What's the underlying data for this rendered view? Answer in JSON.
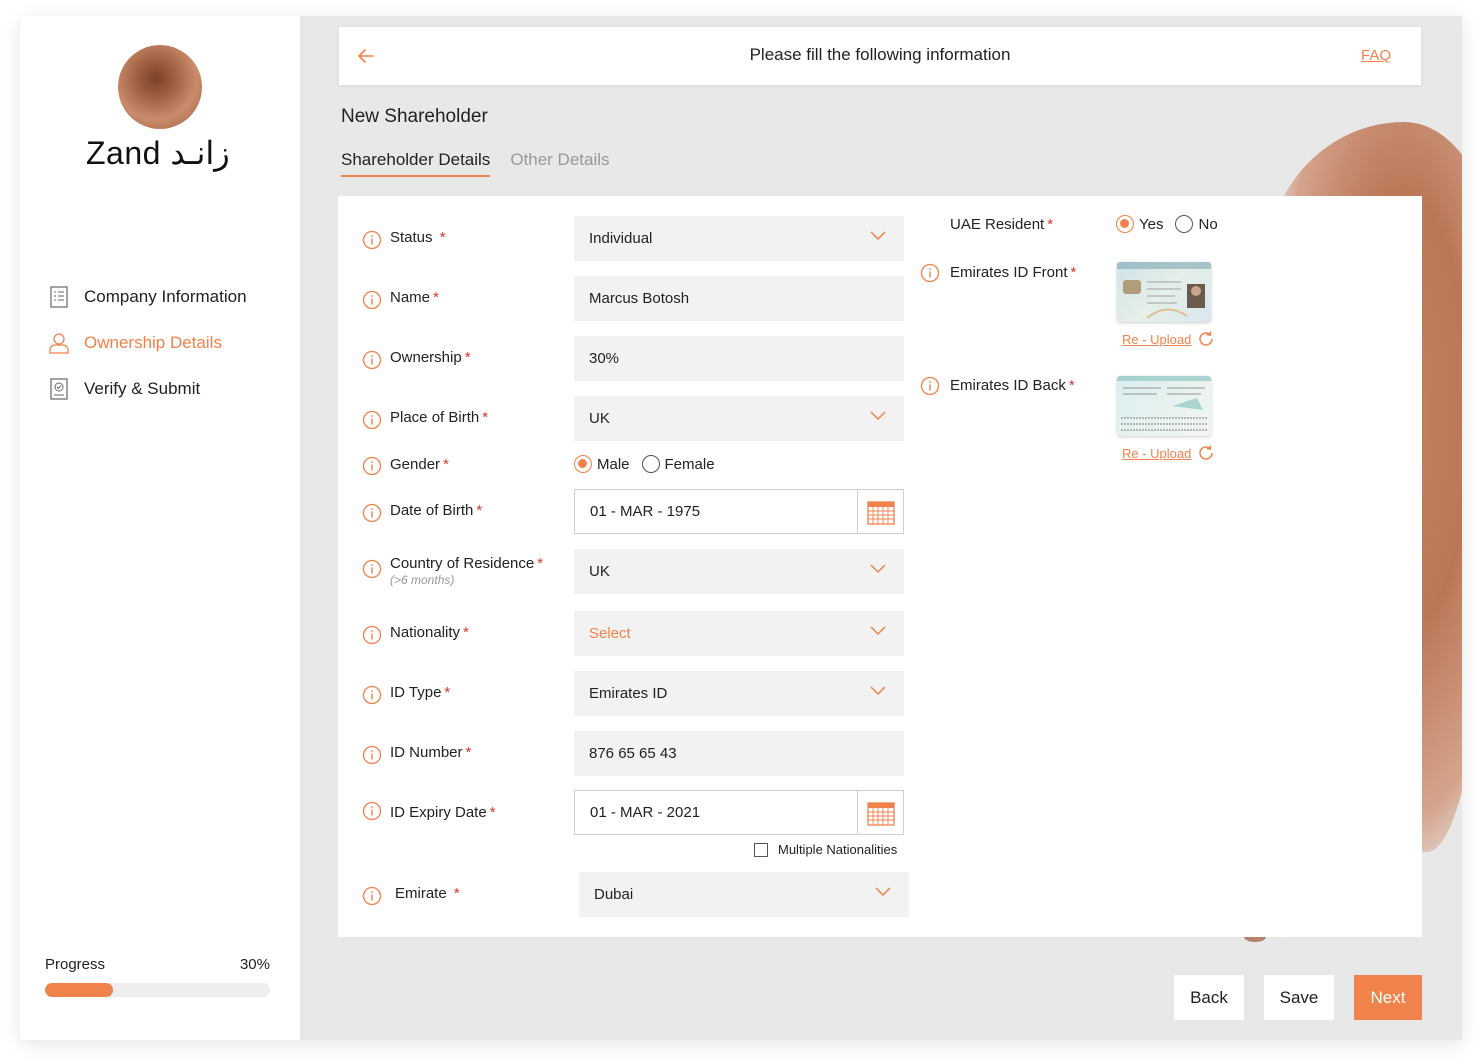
{
  "brand": {
    "logo_text": "Zand زانـد"
  },
  "sidebar": {
    "items": [
      {
        "label": "Company Information",
        "icon": "document-icon",
        "active": false
      },
      {
        "label": "Ownership Details",
        "icon": "user-icon",
        "active": true
      },
      {
        "label": "Verify & Submit",
        "icon": "verify-icon",
        "active": false
      }
    ],
    "progress": {
      "label": "Progress",
      "value_text": "30%",
      "value": 0.3
    }
  },
  "header": {
    "title": "Please fill the following information",
    "faq": "FAQ"
  },
  "section": {
    "title": "New Shareholder"
  },
  "tabs": [
    {
      "label": "Shareholder Details",
      "active": true
    },
    {
      "label": "Other Details",
      "active": false
    }
  ],
  "form": {
    "status": {
      "label": "Status",
      "value": "Individual"
    },
    "name": {
      "label": "Name",
      "value": "Marcus Botosh"
    },
    "ownership": {
      "label": "Ownership",
      "value": "30%"
    },
    "place_of_birth": {
      "label": "Place of Birth",
      "value": "UK"
    },
    "gender": {
      "label": "Gender",
      "options": [
        "Male",
        "Female"
      ],
      "selected": "Male"
    },
    "date_of_birth": {
      "label": "Date of Birth",
      "value": "01 - MAR - 1975"
    },
    "country_of_residence": {
      "label": "Country of Residence",
      "sublabel": "(>6 months)",
      "value": "UK"
    },
    "nationality": {
      "label": "Nationality",
      "placeholder": "Select"
    },
    "id_type": {
      "label": "ID Type",
      "value": "Emirates ID"
    },
    "id_number": {
      "label": "ID Number",
      "value": "876 65 65 43"
    },
    "id_expiry_date": {
      "label": "ID Expiry Date",
      "value": "01 - MAR - 2021"
    },
    "multiple_nationalities": {
      "label": "Multiple Nationalities",
      "checked": false
    },
    "emirate": {
      "label": "Emirate",
      "value": "Dubai"
    },
    "uae_resident": {
      "label": "UAE Resident",
      "options": [
        "Yes",
        "No"
      ],
      "selected": "Yes"
    },
    "emirates_id_front": {
      "label": "Emirates ID Front",
      "reupload": "Re - Upload"
    },
    "emirates_id_back": {
      "label": "Emirates ID Back",
      "reupload": "Re - Upload"
    },
    "required_mark": "*"
  },
  "buttons": {
    "back": "Back",
    "save": "Save",
    "next": "Next"
  },
  "colors": {
    "accent": "#f0824b",
    "required": "#e0332d",
    "field_bg": "#f2f2f2"
  }
}
